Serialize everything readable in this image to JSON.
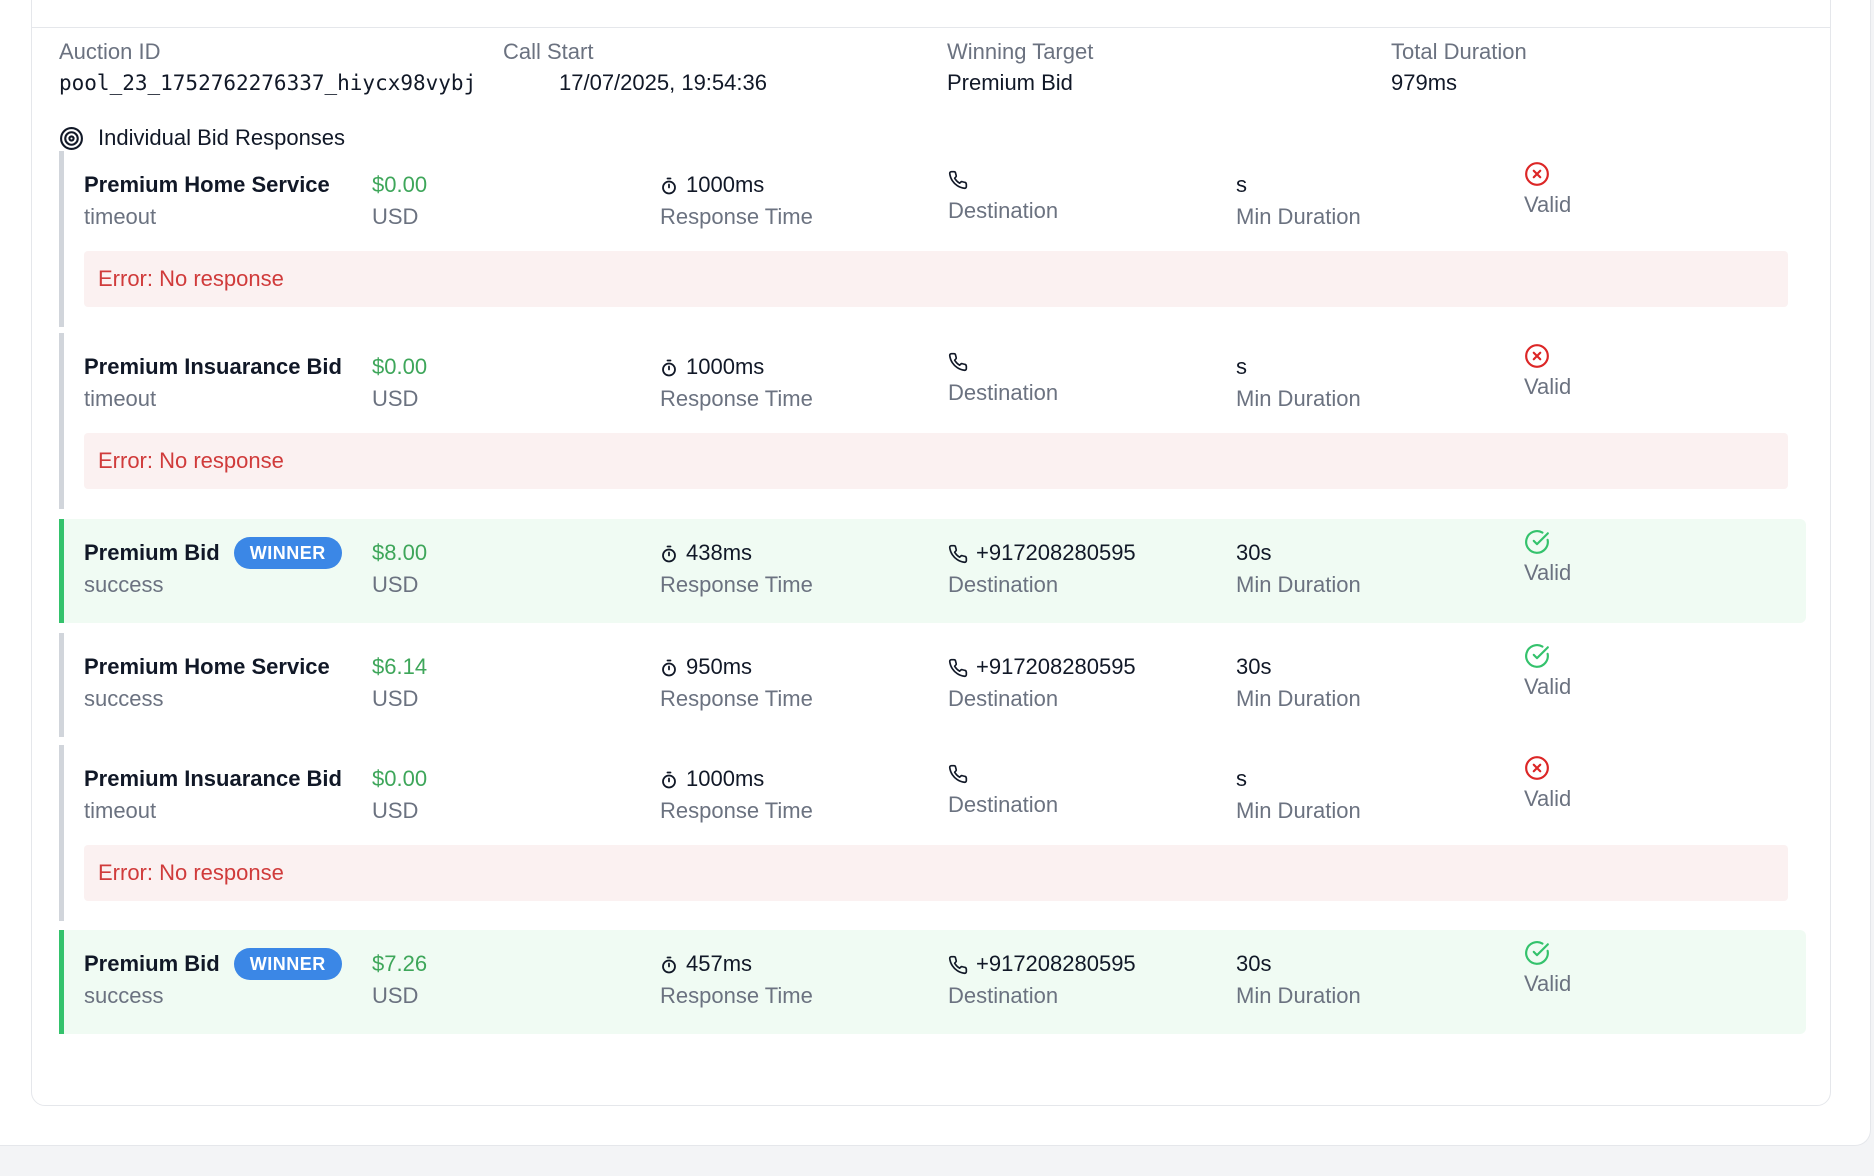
{
  "summary": {
    "auction_id_label": "Auction ID",
    "auction_id": "pool_23_1752762276337_hiycx98vybj",
    "call_start_label": "Call Start",
    "call_start": "17/07/2025, 19:54:36",
    "winning_target_label": "Winning Target",
    "winning_target": "Premium Bid",
    "total_duration_label": "Total Duration",
    "total_duration": "979ms"
  },
  "section": {
    "title": "Individual Bid Responses",
    "icon": "target-icon"
  },
  "labels": {
    "currency": "USD",
    "response_time": "Response Time",
    "destination": "Destination",
    "min_duration": "Min Duration",
    "valid": "Valid",
    "winner_badge": "WINNER"
  },
  "bids": [
    {
      "name": "Premium Home Service",
      "status": "timeout",
      "winner": false,
      "price": "$0.00",
      "response_time": "1000ms",
      "destination": "",
      "min_duration": "s",
      "valid": false,
      "error": "Error: No response"
    },
    {
      "name": "Premium Insuarance Bid",
      "status": "timeout",
      "winner": false,
      "price": "$0.00",
      "response_time": "1000ms",
      "destination": "",
      "min_duration": "s",
      "valid": false,
      "error": "Error: No response"
    },
    {
      "name": "Premium Bid",
      "status": "success",
      "winner": true,
      "price": "$8.00",
      "response_time": "438ms",
      "destination": "+917208280595",
      "min_duration": "30s",
      "valid": true,
      "error": ""
    },
    {
      "name": "Premium Home Service",
      "status": "success",
      "winner": false,
      "price": "$6.14",
      "response_time": "950ms",
      "destination": "+917208280595",
      "min_duration": "30s",
      "valid": true,
      "error": ""
    },
    {
      "name": "Premium Insuarance Bid",
      "status": "timeout",
      "winner": false,
      "price": "$0.00",
      "response_time": "1000ms",
      "destination": "",
      "min_duration": "s",
      "valid": false,
      "error": "Error: No response"
    },
    {
      "name": "Premium Bid",
      "status": "success",
      "winner": true,
      "price": "$7.26",
      "response_time": "457ms",
      "destination": "+917208280595",
      "min_duration": "30s",
      "valid": true,
      "error": ""
    }
  ],
  "colors": {
    "price_green": "#3ea65a",
    "winner_badge": "#3b87e6",
    "winner_bg": "#f0fbf3",
    "winner_border": "#34c26c",
    "error_text": "#d03b3b",
    "error_bg": "#fbf1f1",
    "invalid_icon": "#dc2626",
    "valid_icon": "#34c26c"
  }
}
